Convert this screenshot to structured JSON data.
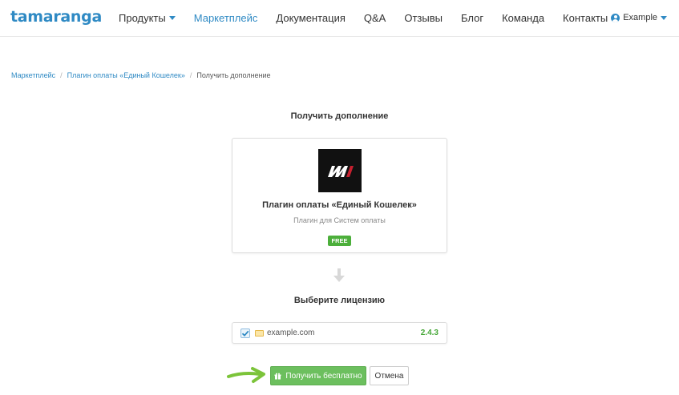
{
  "header": {
    "logo_text": "tamaranga",
    "nav": [
      {
        "label": "Продукты",
        "has_dropdown": true
      },
      {
        "label": "Маркетплейс",
        "active": true
      },
      {
        "label": "Документация"
      },
      {
        "label": "Q&A"
      },
      {
        "label": "Отзывы"
      },
      {
        "label": "Блог"
      },
      {
        "label": "Команда"
      },
      {
        "label": "Контакты"
      }
    ],
    "user": {
      "label": "Example",
      "icon": "user-icon"
    }
  },
  "breadcrumb": [
    {
      "label": "Маркетплейс"
    },
    {
      "label": "Плагин оплаты «Единый Кошелек»"
    },
    {
      "label": "Получить дополнение"
    }
  ],
  "page_title": "Получить дополнение",
  "plugin": {
    "name": "Плагин оплаты «Единый Кошелек»",
    "category": "Плагин для Систем оплаты",
    "price_badge": "FREE"
  },
  "license": {
    "title": "Выберите лицензию",
    "site": "example.com",
    "version": "2.4.3",
    "checked": true
  },
  "actions": {
    "get_label": "Получить бесплатно",
    "cancel_label": "Отмена"
  },
  "colors": {
    "accent": "#2f8ac4",
    "success": "#6cbf5e",
    "badge": "#4caf3b",
    "annotation_arrow": "#7cc43a"
  }
}
